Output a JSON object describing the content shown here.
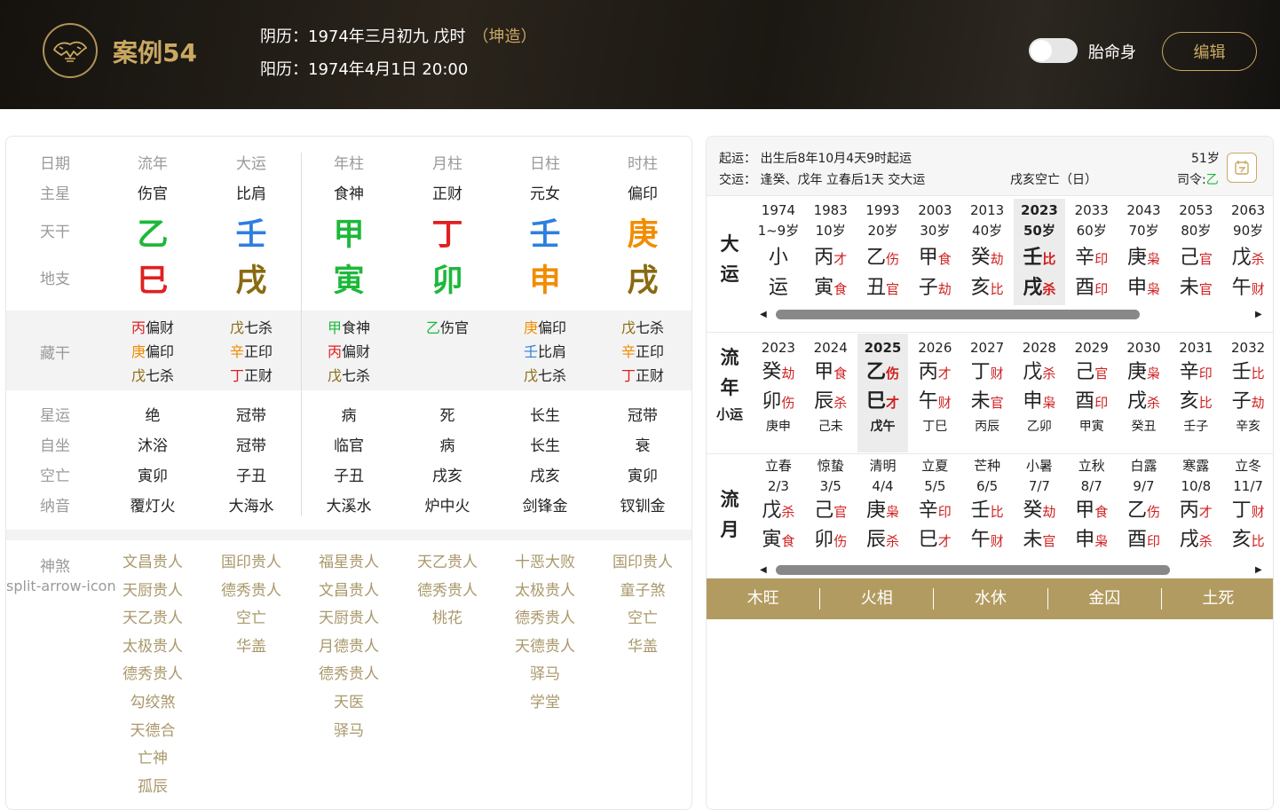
{
  "colors": {
    "gold": "#c9a962",
    "wood": "#1db83a",
    "water": "#2d7fe0",
    "fire": "#e02020",
    "earth": "#8a6a10",
    "metal": "#f28c00",
    "red_ss": "#d02020"
  },
  "header": {
    "logo_icon": "tiger-seal-icon",
    "case_title": "案例54",
    "lunar_label": "阴历：",
    "lunar": "1974年三月初九 戊时",
    "gender": "（坤造）",
    "solar_label": "阳历：",
    "solar": "1974年4月1日 20:00",
    "toggle_label": "胎命身",
    "edit_label": "编辑"
  },
  "chart": {
    "columns": [
      "流年",
      "大运",
      "年柱",
      "月柱",
      "日柱",
      "时柱"
    ],
    "labels": {
      "date": "日期",
      "main_star": "主星",
      "tiangan": "天干",
      "dizhi": "地支",
      "canggan": "藏干",
      "xingyun": "星运",
      "zizuo": "自坐",
      "kongwang": "空亡",
      "nayin": "纳音",
      "shensha": "神煞",
      "shensha_icon": "split-arrow-icon"
    },
    "main_star": [
      "伤官",
      "比肩",
      "食神",
      "正财",
      "元女",
      "偏印"
    ],
    "tiangan": [
      "乙",
      "壬",
      "甲",
      "丁",
      "壬",
      "庚"
    ],
    "tiangan_el": [
      "wood",
      "water",
      "wood",
      "fire",
      "water",
      "metal"
    ],
    "dizhi": [
      "巳",
      "戌",
      "寅",
      "卯",
      "申",
      "戌"
    ],
    "dizhi_el": [
      "fire",
      "earth",
      "wood",
      "wood",
      "metal",
      "earth"
    ],
    "canggan": [
      [
        {
          "g": "丙",
          "ss": "偏财",
          "el": "fire"
        },
        {
          "g": "庚",
          "ss": "偏印",
          "el": "metal"
        },
        {
          "g": "戊",
          "ss": "七杀",
          "el": "earth"
        }
      ],
      [
        {
          "g": "戊",
          "ss": "七杀",
          "el": "earth"
        },
        {
          "g": "辛",
          "ss": "正印",
          "el": "metal"
        },
        {
          "g": "丁",
          "ss": "正财",
          "el": "fire"
        }
      ],
      [
        {
          "g": "甲",
          "ss": "食神",
          "el": "wood"
        },
        {
          "g": "丙",
          "ss": "偏财",
          "el": "fire"
        },
        {
          "g": "戊",
          "ss": "七杀",
          "el": "earth"
        }
      ],
      [
        {
          "g": "乙",
          "ss": "伤官",
          "el": "wood"
        }
      ],
      [
        {
          "g": "庚",
          "ss": "偏印",
          "el": "metal"
        },
        {
          "g": "壬",
          "ss": "比肩",
          "el": "water"
        },
        {
          "g": "戊",
          "ss": "七杀",
          "el": "earth"
        }
      ],
      [
        {
          "g": "戊",
          "ss": "七杀",
          "el": "earth"
        },
        {
          "g": "辛",
          "ss": "正印",
          "el": "metal"
        },
        {
          "g": "丁",
          "ss": "正财",
          "el": "fire"
        }
      ]
    ],
    "xingyun": [
      "绝",
      "冠带",
      "病",
      "死",
      "长生",
      "冠带"
    ],
    "zizuo": [
      "沐浴",
      "冠带",
      "临官",
      "病",
      "长生",
      "衰"
    ],
    "kongwang": [
      "寅卯",
      "子丑",
      "子丑",
      "戌亥",
      "戌亥",
      "寅卯"
    ],
    "nayin": [
      "覆灯火",
      "大海水",
      "大溪水",
      "炉中火",
      "剑锋金",
      "钗钏金"
    ],
    "shensha": [
      [
        "文昌贵人",
        "天厨贵人",
        "天乙贵人",
        "太极贵人",
        "德秀贵人",
        "勾绞煞",
        "天德合",
        "亡神",
        "孤辰"
      ],
      [
        "国印贵人",
        "德秀贵人",
        "空亡",
        "华盖"
      ],
      [
        "福星贵人",
        "文昌贵人",
        "天厨贵人",
        "月德贵人",
        "德秀贵人",
        "天医",
        "驿马"
      ],
      [
        "天乙贵人",
        "德秀贵人",
        "桃花"
      ],
      [
        "十恶大败",
        "太极贵人",
        "德秀贵人",
        "天德贵人",
        "驿马",
        "学堂"
      ],
      [
        "国印贵人",
        "童子煞",
        "空亡",
        "华盖"
      ]
    ]
  },
  "right": {
    "qiyun_label": "起运：",
    "qiyun": "出生后8年10月4天9时起运",
    "jiaoyun_label": "交运：",
    "jiaoyun": "逢癸、戊年 立春后1天 交大运",
    "kongwang": "戌亥空亡（日）",
    "age": "51岁",
    "siling_label": "司令:",
    "siling": "乙",
    "calendar_icon": "calendar-icon",
    "dayun_label": "大运",
    "dayun": [
      {
        "year": "1974",
        "age": "1~9岁",
        "top": "小",
        "bot": "运",
        "top_ss": "",
        "bot_ss": ""
      },
      {
        "year": "1983",
        "age": "10岁",
        "top": "丙",
        "top_ss": "才",
        "bot": "寅",
        "bot_ss": "食"
      },
      {
        "year": "1993",
        "age": "20岁",
        "top": "乙",
        "top_ss": "伤",
        "bot": "丑",
        "bot_ss": "官"
      },
      {
        "year": "2003",
        "age": "30岁",
        "top": "甲",
        "top_ss": "食",
        "bot": "子",
        "bot_ss": "劫"
      },
      {
        "year": "2013",
        "age": "40岁",
        "top": "癸",
        "top_ss": "劫",
        "bot": "亥",
        "bot_ss": "比"
      },
      {
        "year": "2023",
        "age": "50岁",
        "top": "壬",
        "top_ss": "比",
        "bot": "戌",
        "bot_ss": "杀",
        "selected": true
      },
      {
        "year": "2033",
        "age": "60岁",
        "top": "辛",
        "top_ss": "印",
        "bot": "酉",
        "bot_ss": "印"
      },
      {
        "year": "2043",
        "age": "70岁",
        "top": "庚",
        "top_ss": "枭",
        "bot": "申",
        "bot_ss": "枭"
      },
      {
        "year": "2053",
        "age": "80岁",
        "top": "己",
        "top_ss": "官",
        "bot": "未",
        "bot_ss": "官"
      },
      {
        "year": "2063",
        "age": "90岁",
        "top": "戊",
        "top_ss": "杀",
        "bot": "午",
        "bot_ss": "财"
      }
    ],
    "liunian_label": "流年",
    "xiaoyun_label": "小运",
    "liunian": [
      {
        "year": "2023",
        "top": "癸",
        "top_ss": "劫",
        "bot": "卯",
        "bot_ss": "伤",
        "xy": "庚申"
      },
      {
        "year": "2024",
        "top": "甲",
        "top_ss": "食",
        "bot": "辰",
        "bot_ss": "杀",
        "xy": "己未"
      },
      {
        "year": "2025",
        "top": "乙",
        "top_ss": "伤",
        "bot": "巳",
        "bot_ss": "才",
        "xy": "戊午",
        "selected": true
      },
      {
        "year": "2026",
        "top": "丙",
        "top_ss": "才",
        "bot": "午",
        "bot_ss": "财",
        "xy": "丁巳"
      },
      {
        "year": "2027",
        "top": "丁",
        "top_ss": "财",
        "bot": "未",
        "bot_ss": "官",
        "xy": "丙辰"
      },
      {
        "year": "2028",
        "top": "戊",
        "top_ss": "杀",
        "bot": "申",
        "bot_ss": "枭",
        "xy": "乙卯"
      },
      {
        "year": "2029",
        "top": "己",
        "top_ss": "官",
        "bot": "酉",
        "bot_ss": "印",
        "xy": "甲寅"
      },
      {
        "year": "2030",
        "top": "庚",
        "top_ss": "枭",
        "bot": "戌",
        "bot_ss": "杀",
        "xy": "癸丑"
      },
      {
        "year": "2031",
        "top": "辛",
        "top_ss": "印",
        "bot": "亥",
        "bot_ss": "比",
        "xy": "壬子"
      },
      {
        "year": "2032",
        "top": "壬",
        "top_ss": "比",
        "bot": "子",
        "bot_ss": "劫",
        "xy": "辛亥"
      }
    ],
    "liuyue_label": "流月",
    "liuyue": [
      {
        "term": "立春",
        "date": "2/3",
        "top": "戊",
        "top_ss": "杀",
        "bot": "寅",
        "bot_ss": "食"
      },
      {
        "term": "惊蛰",
        "date": "3/5",
        "top": "己",
        "top_ss": "官",
        "bot": "卯",
        "bot_ss": "伤"
      },
      {
        "term": "清明",
        "date": "4/4",
        "top": "庚",
        "top_ss": "枭",
        "bot": "辰",
        "bot_ss": "杀"
      },
      {
        "term": "立夏",
        "date": "5/5",
        "top": "辛",
        "top_ss": "印",
        "bot": "巳",
        "bot_ss": "才"
      },
      {
        "term": "芒种",
        "date": "6/5",
        "top": "壬",
        "top_ss": "比",
        "bot": "午",
        "bot_ss": "财"
      },
      {
        "term": "小暑",
        "date": "7/7",
        "top": "癸",
        "top_ss": "劫",
        "bot": "未",
        "bot_ss": "官"
      },
      {
        "term": "立秋",
        "date": "8/7",
        "top": "甲",
        "top_ss": "食",
        "bot": "申",
        "bot_ss": "枭"
      },
      {
        "term": "白露",
        "date": "9/7",
        "top": "乙",
        "top_ss": "伤",
        "bot": "酉",
        "bot_ss": "印"
      },
      {
        "term": "寒露",
        "date": "10/8",
        "top": "丙",
        "top_ss": "才",
        "bot": "戌",
        "bot_ss": "杀"
      },
      {
        "term": "立冬",
        "date": "11/7",
        "top": "丁",
        "top_ss": "财",
        "bot": "亥",
        "bot_ss": "比"
      }
    ],
    "wuxing": [
      "木旺",
      "火相",
      "水休",
      "金囚",
      "土死"
    ]
  }
}
